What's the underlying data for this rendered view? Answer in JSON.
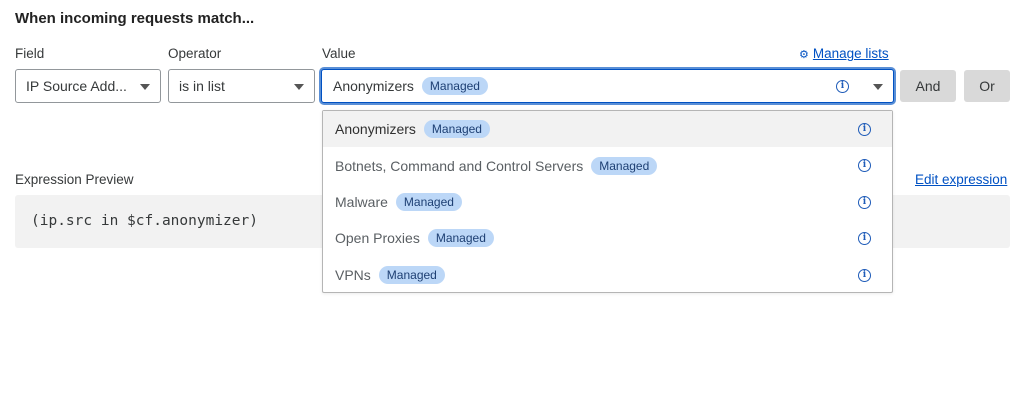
{
  "heading": "When incoming requests match...",
  "labels": {
    "field": "Field",
    "operator": "Operator",
    "value": "Value"
  },
  "manage_lists": {
    "icon": "gear-icon",
    "label": "Manage lists"
  },
  "field_select": {
    "value": "IP Source Add..."
  },
  "operator_select": {
    "value": "is in list"
  },
  "value_select": {
    "value": "Anonymizers",
    "badge": "Managed"
  },
  "buttons": {
    "and": "And",
    "or": "Or"
  },
  "dropdown": {
    "options": [
      {
        "label": "Anonymizers",
        "badge": "Managed",
        "selected": true
      },
      {
        "label": "Botnets, Command and Control Servers",
        "badge": "Managed"
      },
      {
        "label": "Malware",
        "badge": "Managed"
      },
      {
        "label": "Open Proxies",
        "badge": "Managed"
      },
      {
        "label": "VPNs",
        "badge": "Managed"
      }
    ]
  },
  "expression": {
    "label": "Expression Preview",
    "edit_label": "Edit expression",
    "code": "(ip.src in $cf.anonymizer)"
  },
  "info_glyph": "i",
  "colors": {
    "accent": "#0051c3",
    "badge_bg": "#bcd7f7",
    "button_bg": "#d9d9d9",
    "preview_bg": "#f2f2f2"
  }
}
